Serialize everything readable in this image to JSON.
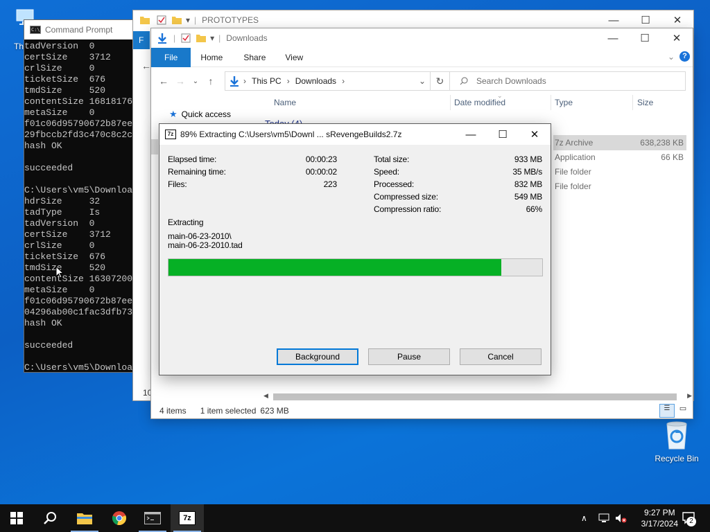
{
  "desktop": {
    "this_pc_label": "Th",
    "recycle_bin_label": "Recycle Bin"
  },
  "cmd": {
    "title": "Command Prompt",
    "lines": [
      "tadVersion  0",
      "certSize    3712",
      "crlSize     0",
      "ticketSize  676",
      "tmdSize     520",
      "contentSize 16818176",
      "metaSize    0",
      "f01c06d95790672b87ee",
      "29fbccb2fd3c470c8c2c",
      "hash OK",
      "",
      "succeeded",
      "",
      "C:\\Users\\vm5\\Downloa",
      "hdrSize     32",
      "tadType     Is",
      "tadVersion  0",
      "certSize    3712",
      "crlSize     0",
      "ticketSize  676",
      "tmdSize     520",
      "contentSize 16307200",
      "metaSize    0",
      "f01c06d95790672b87ee",
      "04296ab00c1fac3dfb73",
      "hash OK",
      "",
      "succeeded",
      "",
      "C:\\Users\\vm5\\Downloa"
    ]
  },
  "explorer_back": {
    "title": "PROTOTYPES",
    "ribbon_file": "F",
    "count_fragment": "10"
  },
  "explorer_front": {
    "title": "Downloads",
    "ribbon": {
      "file": "File",
      "home": "Home",
      "share": "Share",
      "view": "View"
    },
    "address": {
      "this_pc": "This PC",
      "downloads": "Downloads"
    },
    "search_placeholder": "Search Downloads",
    "columns": {
      "name": "Name",
      "date": "Date modified",
      "type": "Type",
      "size": "Size"
    },
    "nav_quick_access": "Quick access",
    "group_label": "Today (4)",
    "rows": [
      {
        "type": "7z Archive",
        "size": "638,238 KB"
      },
      {
        "type": "Application",
        "size": "66 KB"
      },
      {
        "type": "File folder",
        "size": ""
      },
      {
        "type": "File folder",
        "size": ""
      }
    ],
    "status": {
      "items": "4 items",
      "selected": "1 item selected",
      "size": "623 MB"
    }
  },
  "sevenzip": {
    "title": "89% Extracting C:\\Users\\vm5\\Downl ... sRevengeBuilds2.7z",
    "icon_text": "7z",
    "left": [
      {
        "label": "Elapsed time:",
        "value": "00:00:23"
      },
      {
        "label": "Remaining time:",
        "value": "00:00:02"
      },
      {
        "label": "Files:",
        "value": "223"
      }
    ],
    "right": [
      {
        "label": "Total size:",
        "value": "933 MB"
      },
      {
        "label": "Speed:",
        "value": "35 MB/s"
      },
      {
        "label": "Processed:",
        "value": "832 MB"
      },
      {
        "label": "Compressed size:",
        "value": "549 MB"
      },
      {
        "label": "Compression ratio:",
        "value": "66%"
      }
    ],
    "extracting_label": "Extracting",
    "path_line1": "main-06-23-2010\\",
    "path_line2": "main-06-23-2010.tad",
    "progress_percent": 89,
    "buttons": {
      "background": "Background",
      "pause": "Pause",
      "cancel": "Cancel"
    }
  },
  "taskbar": {
    "time": "9:27 PM",
    "date": "3/17/2024",
    "notification_count": "2",
    "sevenzip_label": "7z"
  },
  "colors": {
    "desktop_blue": "#0c5fc4",
    "progress_green": "#06b025",
    "ribbon_blue": "#1979ca",
    "taskbar": "#101010"
  }
}
